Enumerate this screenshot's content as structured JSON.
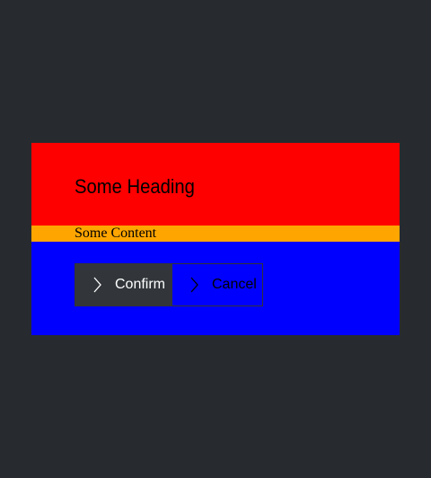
{
  "dialog": {
    "heading": "Some Heading",
    "content": "Some Content",
    "buttons": {
      "confirm": {
        "label": "Confirm",
        "icon": "chevron-right-icon"
      },
      "cancel": {
        "label": "Cancel",
        "icon": "chevron-right-icon"
      }
    }
  },
  "colors": {
    "background": "#272b2f",
    "header": "#ff0000",
    "content": "#ffa500",
    "footer": "#0000ff",
    "confirm_bg": "#32363a"
  }
}
